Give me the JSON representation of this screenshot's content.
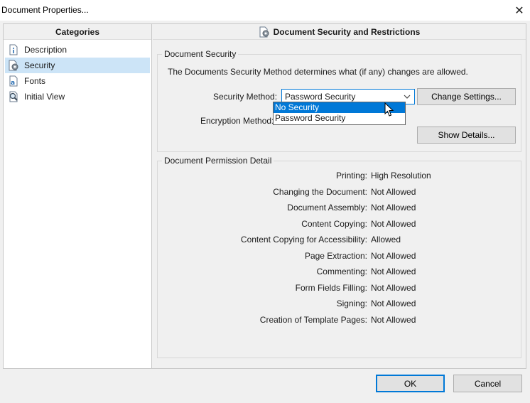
{
  "window": {
    "title": "Document Properties..."
  },
  "categories": {
    "header": "Categories",
    "items": [
      {
        "label": "Description",
        "icon": "info-page-icon"
      },
      {
        "label": "Security",
        "icon": "lock-gear-icon"
      },
      {
        "label": "Fonts",
        "icon": "font-page-icon"
      },
      {
        "label": "Initial View",
        "icon": "magnifier-icon"
      }
    ],
    "selected": "Security"
  },
  "panel": {
    "header": "Document Security and Restrictions"
  },
  "security": {
    "legend": "Document Security",
    "description": "The Documents Security Method determines what (if any) changes are allowed.",
    "method_label": "Security Method:",
    "method_value": "Password Security",
    "encryption_label": "Encryption Method:",
    "change_settings": "Change Settings...",
    "show_details": "Show Details...",
    "dropdown_options": [
      "No Security",
      "Password Security"
    ],
    "dropdown_highlighted": "No Security"
  },
  "permissions": {
    "legend": "Document Permission Detail",
    "rows": [
      {
        "key": "Printing:",
        "value": "High Resolution"
      },
      {
        "key": "Changing the Document:",
        "value": "Not Allowed"
      },
      {
        "key": "Document Assembly:",
        "value": "Not Allowed"
      },
      {
        "key": "Content Copying:",
        "value": "Not Allowed"
      },
      {
        "key": "Content Copying for Accessibility:",
        "value": "Allowed"
      },
      {
        "key": "Page Extraction:",
        "value": "Not Allowed"
      },
      {
        "key": "Commenting:",
        "value": "Not Allowed"
      },
      {
        "key": "Form Fields Filling:",
        "value": "Not Allowed"
      },
      {
        "key": "Signing:",
        "value": "Not Allowed"
      },
      {
        "key": "Creation of Template Pages:",
        "value": "Not Allowed"
      }
    ]
  },
  "buttons": {
    "ok": "OK",
    "cancel": "Cancel"
  },
  "colors": {
    "accent": "#0078d7",
    "selection": "#cce4f7",
    "button_face": "#e1e1e1"
  }
}
